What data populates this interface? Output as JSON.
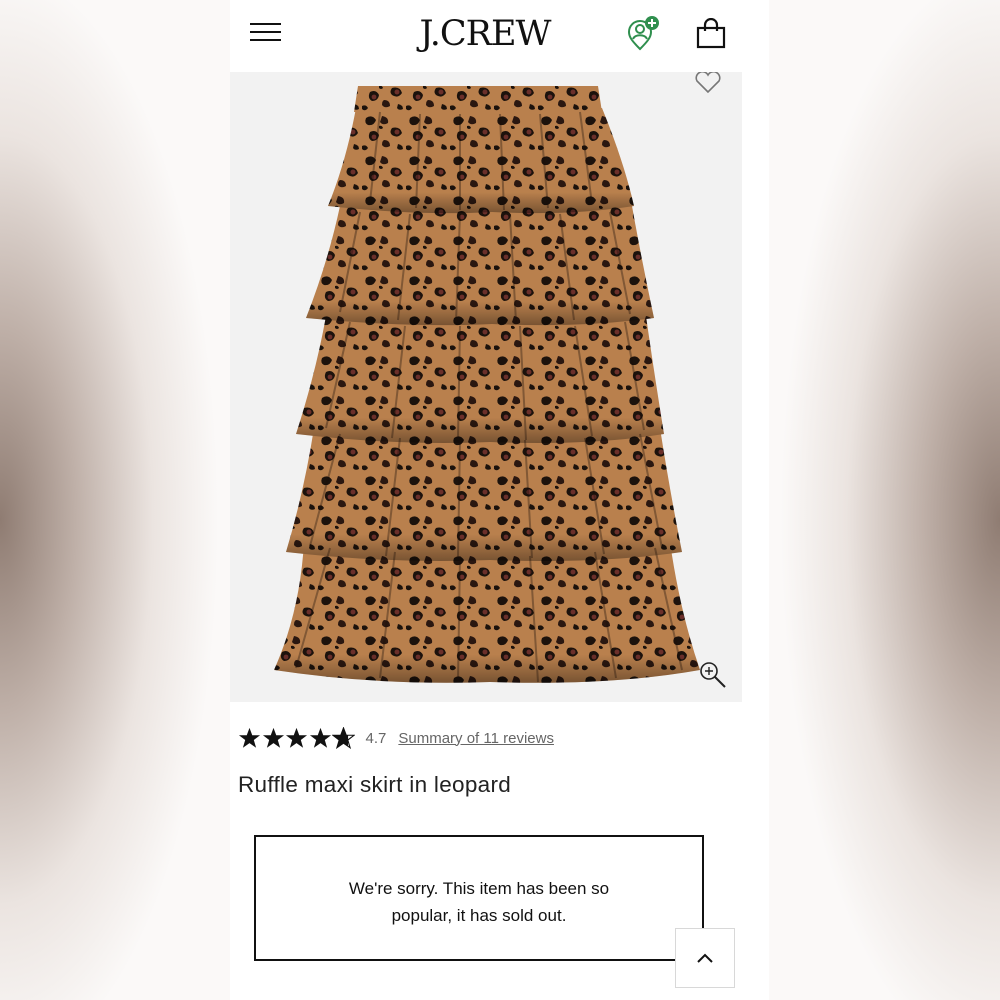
{
  "header": {
    "brand": "J.CREW",
    "icons": [
      "menu-icon",
      "account-icon",
      "bag-icon"
    ]
  },
  "product": {
    "image_icons": [
      "heart-icon",
      "zoom-icon"
    ],
    "rating": 4.7,
    "rating_label": "4.7",
    "reviews_link": "Summary of 11 reviews",
    "title": "Ruffle maxi skirt in leopard"
  },
  "status": {
    "message_line1": "We're sorry. This item has been so",
    "message_line2": "popular, it has sold out."
  },
  "colors": {
    "accent_green": "#2f8f4e",
    "text": "#111111",
    "muted": "#666666"
  }
}
